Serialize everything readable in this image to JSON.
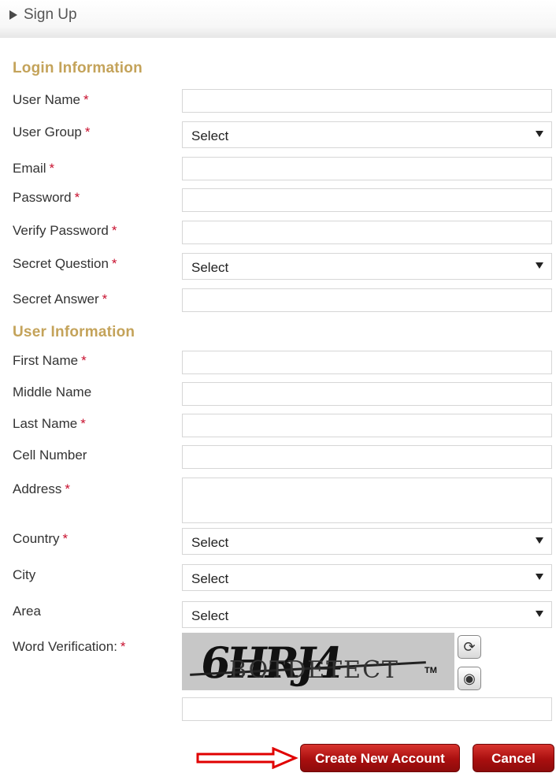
{
  "header": {
    "title": "Sign Up"
  },
  "sections": {
    "login": "Login Information",
    "user": "User Information"
  },
  "labels": {
    "user_name": "User Name",
    "user_group": "User Group",
    "email": "Email",
    "password": "Password",
    "verify_password": "Verify Password",
    "secret_question": "Secret Question",
    "secret_answer": "Secret Answer",
    "first_name": "First Name",
    "middle_name": "Middle Name",
    "last_name": "Last Name",
    "cell_number": "Cell Number",
    "address": "Address",
    "country": "Country",
    "city": "City",
    "area": "Area",
    "word_verification": "Word Verification:"
  },
  "required_mark": "*",
  "selects": {
    "user_group": "Select",
    "secret_question": "Select",
    "country": "Select",
    "city": "Select",
    "area": "Select"
  },
  "captcha": {
    "text": "6HRJ4",
    "overlay": "BOTDETECT",
    "tm": "TM"
  },
  "buttons": {
    "create": "Create New Account",
    "cancel": "Cancel"
  },
  "colors": {
    "section": "#c4a35a",
    "required": "#c8102e",
    "button": "#b3120f",
    "arrow": "#e00000"
  }
}
